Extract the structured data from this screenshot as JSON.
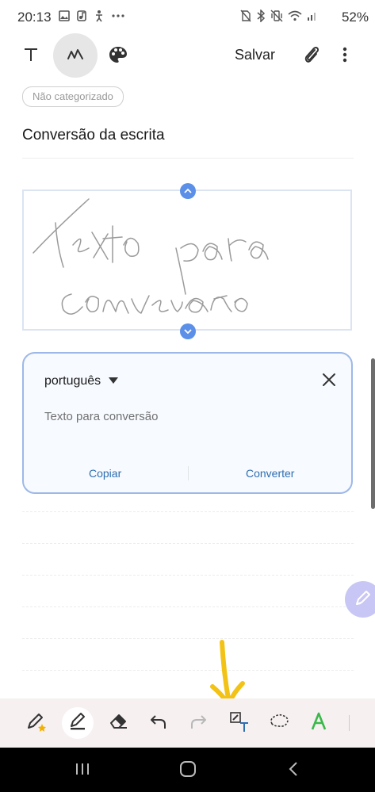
{
  "status": {
    "time": "20:13",
    "battery": "52%",
    "left_icons": [
      "image-icon",
      "music-note-icon",
      "accessibility-icon",
      "more-dots-icon"
    ],
    "right_icons": [
      "no-sim-icon",
      "bluetooth-icon",
      "vibrate-icon",
      "wifi-icon",
      "signal-icon"
    ]
  },
  "toolbar": {
    "save_label": "Salvar",
    "icons": [
      "text-mode-icon",
      "pen-mode-icon",
      "palette-icon",
      "attach-icon",
      "more-vert-icon"
    ]
  },
  "note": {
    "category": "Não categorizado",
    "title": "Conversão da escrita",
    "handwriting": "Texto para conversão"
  },
  "convert_panel": {
    "language": "português",
    "converted_text": "Texto para conversão",
    "copy_label": "Copiar",
    "convert_label": "Converter"
  },
  "colors": {
    "accent_blue": "#5b8fe8",
    "panel_border": "#9db8e8",
    "action_text": "#2d6eb0",
    "annotation_arrow": "#f2c316",
    "pen_toolbar_bg": "#f6f0f1"
  },
  "pen_toolbar": {
    "tools": [
      "pen-favorite-icon",
      "highlighter-pen-icon",
      "eraser-icon",
      "undo-icon",
      "redo-icon",
      "handwriting-to-text-icon",
      "lasso-icon",
      "text-style-icon"
    ]
  },
  "navbar": {
    "buttons": [
      "recents-icon",
      "home-icon",
      "back-icon"
    ]
  }
}
